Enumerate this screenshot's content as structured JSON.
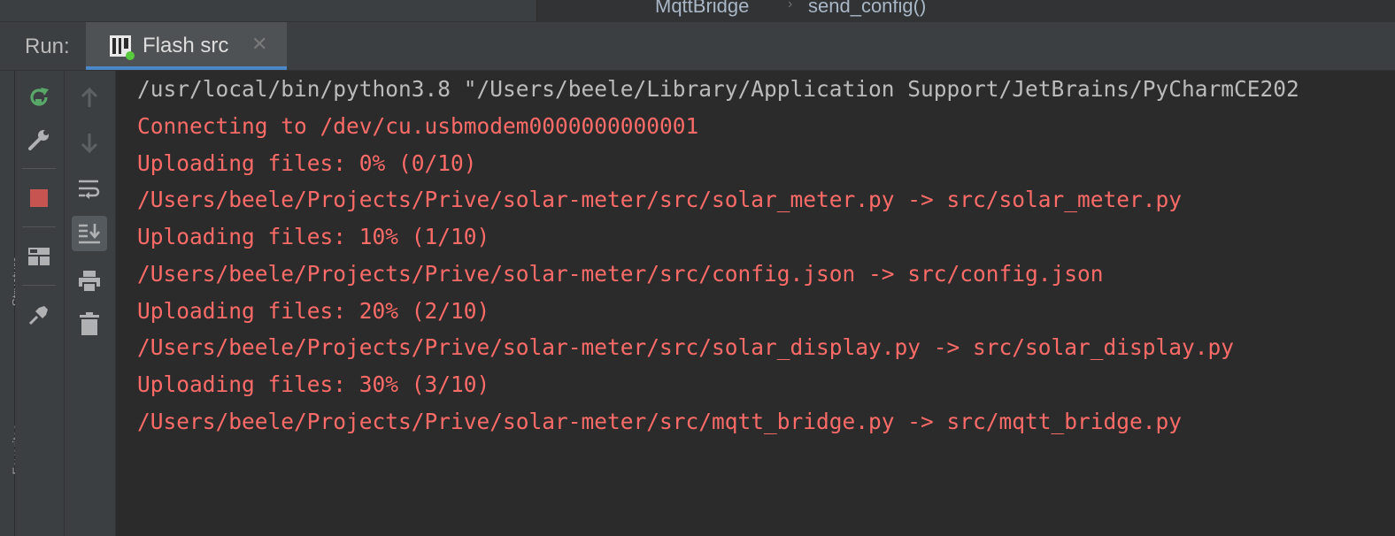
{
  "breadcrumb": {
    "class_name": "MqttBridge",
    "separator": "›",
    "method_name": "send_config()"
  },
  "run_window": {
    "label": "Run:",
    "tab": {
      "title": "Flash src",
      "icon": "run-config-icon",
      "close_glyph": "✕"
    }
  },
  "side_strip": {
    "labels": [
      "Structure",
      "Favorites"
    ]
  },
  "toolbar_primary": [
    {
      "name": "rerun-icon",
      "tooltip": "Rerun"
    },
    {
      "name": "wrench-icon",
      "tooltip": "Modify run configuration"
    },
    {
      "name": "stop-icon",
      "tooltip": "Stop"
    },
    {
      "name": "layout-icon",
      "tooltip": "Restore layout"
    },
    {
      "name": "pin-icon",
      "tooltip": "Pin tab"
    }
  ],
  "toolbar_secondary": [
    {
      "name": "arrow-up-icon",
      "tooltip": "Up the stack trace"
    },
    {
      "name": "arrow-down-icon",
      "tooltip": "Down the stack trace"
    },
    {
      "name": "soft-wrap-icon",
      "tooltip": "Soft-wrap"
    },
    {
      "name": "scroll-to-end-icon",
      "tooltip": "Scroll to the end",
      "pressed": true
    },
    {
      "name": "print-icon",
      "tooltip": "Print"
    },
    {
      "name": "trash-icon",
      "tooltip": "Clear all"
    }
  ],
  "console": {
    "lines": [
      {
        "type": "cmd",
        "text": "/usr/local/bin/python3.8 \"/Users/beele/Library/Application Support/JetBrains/PyCharmCE202"
      },
      {
        "type": "err",
        "text": "Connecting to /dev/cu.usbmodem0000000000001"
      },
      {
        "type": "err",
        "text": "Uploading files: 0% (0/10)"
      },
      {
        "type": "err",
        "text": "/Users/beele/Projects/Prive/solar-meter/src/solar_meter.py -> src/solar_meter.py"
      },
      {
        "type": "err",
        "text": "Uploading files: 10% (1/10)"
      },
      {
        "type": "err",
        "text": "/Users/beele/Projects/Prive/solar-meter/src/config.json -> src/config.json"
      },
      {
        "type": "err",
        "text": "Uploading files: 20% (2/10)"
      },
      {
        "type": "err",
        "text": "/Users/beele/Projects/Prive/solar-meter/src/solar_display.py -> src/solar_display.py"
      },
      {
        "type": "err",
        "text": "Uploading files: 30% (3/10)"
      },
      {
        "type": "err",
        "text": "/Users/beele/Projects/Prive/solar-meter/src/mqtt_bridge.py -> src/mqtt_bridge.py"
      }
    ]
  },
  "colors": {
    "background": "#2b2b2b",
    "panel": "#3c3f41",
    "command_text": "#bbbbbb",
    "stderr_text": "#ff6b68",
    "rerun_green": "#59a869",
    "stop_red": "#c75450",
    "running_dot": "#59c93e"
  }
}
